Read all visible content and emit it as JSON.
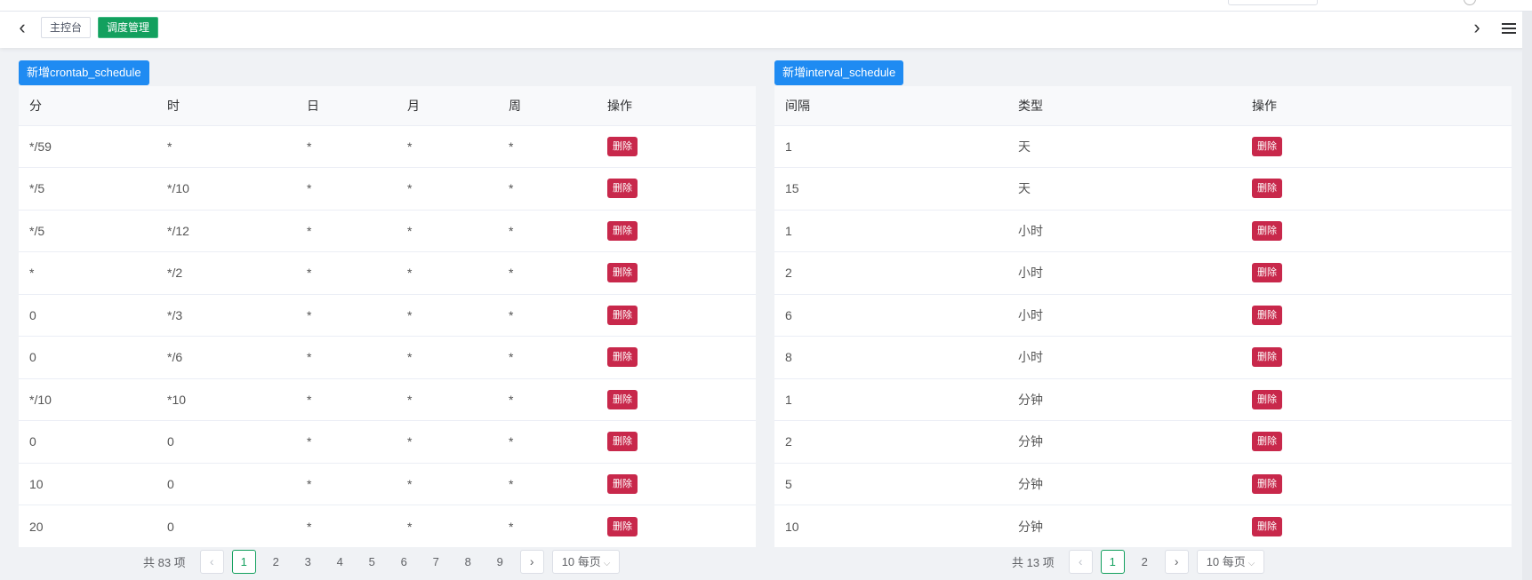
{
  "tags": {
    "home": "主控台",
    "current": "调度管理"
  },
  "nav": {
    "back_icon": "chevron-left-icon",
    "forward_icon": "chevron-right-icon",
    "menu_icon": "hamburger-icon"
  },
  "colors": {
    "primary_blue": "#1f8bf2",
    "active_green": "#13a05e",
    "delete_red": "#c8284b"
  },
  "crontab": {
    "add_label": "新增crontab_schedule",
    "columns": [
      "分",
      "时",
      "日",
      "月",
      "周",
      "操作"
    ],
    "rows": [
      [
        "*/59",
        "*",
        "*",
        "*",
        "*"
      ],
      [
        "*/5",
        "*/10",
        "*",
        "*",
        "*"
      ],
      [
        "*/5",
        "*/12",
        "*",
        "*",
        "*"
      ],
      [
        "*",
        "*/2",
        "*",
        "*",
        "*"
      ],
      [
        "0",
        "*/3",
        "*",
        "*",
        "*"
      ],
      [
        "0",
        "*/6",
        "*",
        "*",
        "*"
      ],
      [
        "*/10",
        "*10",
        "*",
        "*",
        "*"
      ],
      [
        "0",
        "0",
        "*",
        "*",
        "*"
      ],
      [
        "10",
        "0",
        "*",
        "*",
        "*"
      ],
      [
        "20",
        "0",
        "*",
        "*",
        "*"
      ]
    ],
    "delete_label": "删除",
    "pagination": {
      "total": "共 83 项",
      "pages": [
        "1",
        "2",
        "3",
        "4",
        "5",
        "6",
        "7",
        "8",
        "9"
      ],
      "current": "1",
      "page_size": "10 每页"
    }
  },
  "interval": {
    "add_label": "新增interval_schedule",
    "columns": [
      "间隔",
      "类型",
      "操作"
    ],
    "rows": [
      [
        "1",
        "天"
      ],
      [
        "15",
        "天"
      ],
      [
        "1",
        "小时"
      ],
      [
        "2",
        "小时"
      ],
      [
        "6",
        "小时"
      ],
      [
        "8",
        "小时"
      ],
      [
        "1",
        "分钟"
      ],
      [
        "2",
        "分钟"
      ],
      [
        "5",
        "分钟"
      ],
      [
        "10",
        "分钟"
      ]
    ],
    "delete_label": "删除",
    "pagination": {
      "total": "共 13 项",
      "pages": [
        "1",
        "2"
      ],
      "current": "1",
      "page_size": "10 每页"
    }
  }
}
